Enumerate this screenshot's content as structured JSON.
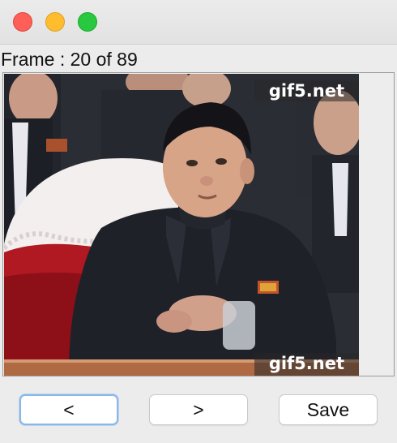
{
  "window": {
    "buttons": [
      "close",
      "minimize",
      "maximize"
    ]
  },
  "frame_label": "Frame : 20 of 89",
  "frame": {
    "current": 20,
    "total": 89
  },
  "image": {
    "watermark_top": "gif5.net",
    "watermark_bottom": "gif5.net"
  },
  "controls": {
    "prev_label": "<",
    "next_label": ">",
    "save_label": "Save"
  },
  "colors": {
    "close": "#fe5f57",
    "minimize": "#febc2e",
    "maximize": "#28c840",
    "focus_ring": "#8ab8e6"
  }
}
